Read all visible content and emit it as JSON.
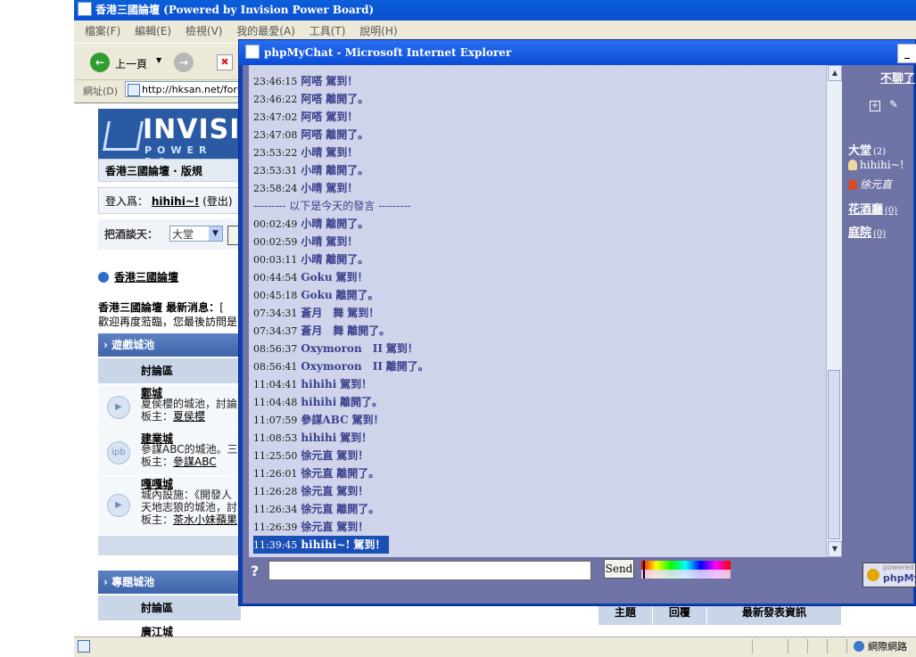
{
  "ie": {
    "title": "香港三國論壇 (Powered by Invision Power Board)",
    "menu": [
      "檔案(F)",
      "編輯(E)",
      "檢視(V)",
      "我的最愛(A)",
      "工具(T)",
      "說明(H)"
    ],
    "back_label": "上一頁",
    "address_label": "網址(D)",
    "address_value": "http://hksan.net/forum/",
    "status_zone": "網際網路"
  },
  "forum": {
    "logo_text": "INVISIO",
    "logo_sub": "POWER BO",
    "nav": "香港三國論壇 · 版規",
    "login_prefix": "登入爲：",
    "login_user": "hihihi~!",
    "login_logout": "(登出)",
    "chat_label": "把酒談天：",
    "room_selected": "大堂",
    "title": "香港三國論壇",
    "news_label": "香港三國論壇 最新消息：",
    "news_link": "[",
    "welcome": "歡迎再度蒞臨，您最後訪問是",
    "cat1": "遊戲城池",
    "col_forum": "討論區",
    "rows": [
      {
        "icon": "▶",
        "name": "鄴城",
        "desc": "夏侯櫻的城池，討論",
        "mod_prefix": "板主：",
        "mod": "夏侯櫻"
      },
      {
        "icon": "ipb",
        "name": "建業城",
        "desc": "參謀ABC的城池。三",
        "mod_prefix": "板主：",
        "mod": "參謀ABC"
      },
      {
        "icon": "▶",
        "name": "嘎嘎城",
        "desc": "城內設施：《開發人",
        "desc2": "天地志狼的城池，討",
        "mod_prefix": "板主：",
        "mod": "茶水小妹蘋果"
      }
    ],
    "cat2": "專題城池",
    "col_forum2": "討論區",
    "col_topics": "主題",
    "col_replies": "回覆",
    "col_last": "最新發表資訊",
    "row_cut": "廣江城"
  },
  "chat": {
    "title": "phpMyChat - Microsoft Internet Explorer",
    "messages": [
      {
        "time": "23:46:15",
        "name": "阿嗒",
        "action": "駕到！"
      },
      {
        "time": "23:46:22",
        "name": "阿嗒",
        "action": "離開了。"
      },
      {
        "time": "23:47:02",
        "name": "阿嗒",
        "action": "駕到！"
      },
      {
        "time": "23:47:08",
        "name": "阿嗒",
        "action": "離開了。"
      },
      {
        "time": "23:53:22",
        "name": "小晴",
        "action": "駕到！"
      },
      {
        "time": "23:53:31",
        "name": "小晴",
        "action": "離開了。"
      },
      {
        "time": "23:58:24",
        "name": "小晴",
        "action": "駕到！"
      },
      {
        "separator": "--------- 以下是今天的發言 ---------"
      },
      {
        "time": "00:02:49",
        "name": "小晴",
        "action": "離開了。"
      },
      {
        "time": "00:02:59",
        "name": "小晴",
        "action": "駕到！"
      },
      {
        "time": "00:03:11",
        "name": "小晴",
        "action": "離開了。"
      },
      {
        "time": "00:44:54",
        "name": "Goku",
        "action": "駕到！"
      },
      {
        "time": "00:45:18",
        "name": "Goku",
        "action": "離開了。"
      },
      {
        "time": "07:34:31",
        "name": "蒼月　舞",
        "action": "駕到！"
      },
      {
        "time": "07:34:37",
        "name": "蒼月　舞",
        "action": "離開了。"
      },
      {
        "time": "08:56:37",
        "name": "Oxymoron　II",
        "action": "駕到！"
      },
      {
        "time": "08:56:41",
        "name": "Oxymoron　II",
        "action": "離開了。"
      },
      {
        "time": "11:04:41",
        "name": "hihihi",
        "action": "駕到！"
      },
      {
        "time": "11:04:48",
        "name": "hihihi",
        "action": "離開了。"
      },
      {
        "time": "11:07:59",
        "name": "參謀ABC",
        "action": "駕到！"
      },
      {
        "time": "11:08:53",
        "name": "hihihi",
        "action": "駕到！"
      },
      {
        "time": "11:25:50",
        "name": "徐元直",
        "action": "駕到！"
      },
      {
        "time": "11:26:01",
        "name": "徐元直",
        "action": "離開了。"
      },
      {
        "time": "11:26:28",
        "name": "徐元直",
        "action": "駕到！"
      },
      {
        "time": "11:26:34",
        "name": "徐元直",
        "action": "離開了。"
      },
      {
        "time": "11:26:39",
        "name": "徐元直",
        "action": "駕到！"
      },
      {
        "time": "11:39:45",
        "name": "hihihi~!",
        "action": "駕到！",
        "highlight": true
      }
    ],
    "help": "?",
    "input_value": "",
    "send": "Send",
    "leave": "不聊了",
    "rooms": [
      {
        "name": "大堂",
        "count": "(2)"
      },
      {
        "name": "花酒廳",
        "count": "(0)"
      },
      {
        "name": "庭院",
        "count": "(0)"
      }
    ],
    "users": [
      "hihihi~!",
      "徐元直"
    ],
    "powered1": "powered",
    "powered2": "phpMy"
  },
  "colors": {
    "ie_title": "#0b4ed0",
    "chat_bg": "#6f73a6",
    "message_pane": "#cfd4ea",
    "name_color": "#3a3f8c",
    "highlight": "#1a4fb5"
  }
}
